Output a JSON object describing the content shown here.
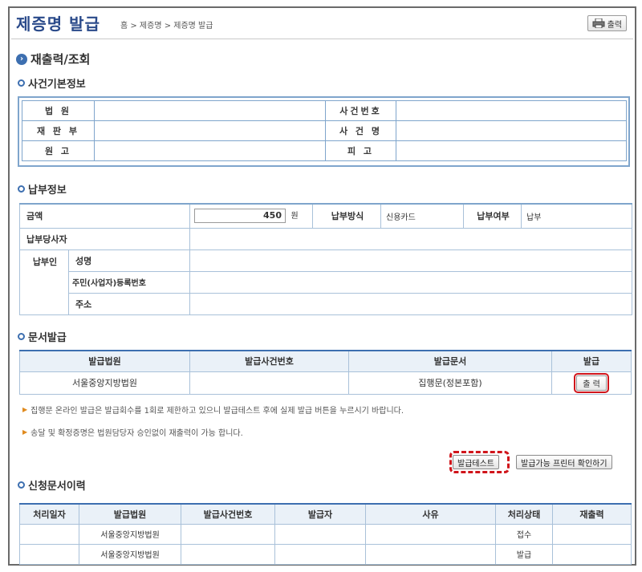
{
  "header": {
    "title": "제증명 발급",
    "breadcrumb": "홈 > 제증명 > 제증명 발급",
    "print_label": "출력"
  },
  "section_main": "재출력/조회",
  "case_info": {
    "heading": "사건기본정보",
    "court_label": "법 원",
    "court_value": "",
    "case_no_label": "사건번호",
    "case_no_value": "",
    "division_label": "재 판 부",
    "division_value": "",
    "case_name_label": "사 건 명",
    "case_name_value": "",
    "plaintiff_label": "원 고",
    "plaintiff_value": "",
    "defendant_label": "피 고",
    "defendant_value": ""
  },
  "payment": {
    "heading": "납부정보",
    "amount_label": "금액",
    "amount_value": "450",
    "amount_unit": "원",
    "method_label": "납부방식",
    "method_value": "신용카드",
    "status_label": "납부여부",
    "status_value": "납부",
    "party_label": "납부당사자",
    "payer_label": "납부인",
    "name_label": "성명",
    "id_label": "주민(사업자)등록번호",
    "address_label": "주소"
  },
  "doc_issue": {
    "heading": "문서발급",
    "col_court": "발급법원",
    "col_case_no": "발급사건번호",
    "col_doc": "발급문서",
    "col_issue": "발급",
    "row_court": "서울중앙지방법원",
    "row_case_no": "",
    "row_doc": "집행문(정본포함)",
    "row_button": "출 력",
    "note1": "집행문 온라인 발급은 발급회수를 1회로 제한하고 있으니 발급테스트 후에 실제 발급 버튼을 누르시기 바랍니다.",
    "note2": "송달 및 확정증명은 법원담당자 승인없이 재출력이 가능 합니다.",
    "test_button": "발급테스트",
    "printer_button": "발급가능 프린터 확인하기"
  },
  "history": {
    "heading": "신청문서이력",
    "columns": [
      "처리일자",
      "발급법원",
      "발급사건번호",
      "발급자",
      "사유",
      "처리상태",
      "재출력"
    ],
    "rows": [
      [
        "",
        "서울중앙지방법원",
        "",
        "",
        "",
        "접수",
        ""
      ],
      [
        "",
        "서울중앙지방법원",
        "",
        "",
        "",
        "발급",
        ""
      ]
    ]
  },
  "colors": {
    "accent": "#3d6fb0",
    "highlight_red": "#d0151b",
    "table_border": "#7fa5cc"
  }
}
